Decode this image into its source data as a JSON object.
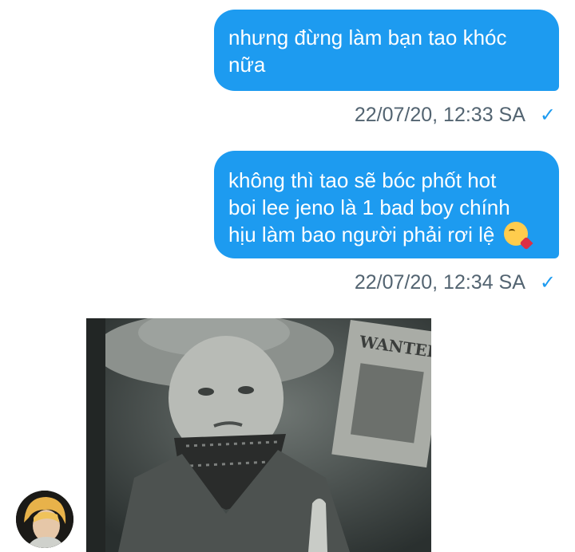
{
  "messages": [
    {
      "lines": [
        "nhưng đừng làm bạn tao khóc",
        "nữa"
      ],
      "timestamp": "22/07/20, 12:33 SA",
      "status_icon": "check-icon"
    },
    {
      "lines": [
        "không thì tao sẽ bóc phốt hot",
        "boi lee jeno là 1 bad boy chính",
        "hịu làm bao người phải rơi lệ"
      ],
      "emoji": "face-blowing-kiss-emoji",
      "timestamp": "22/07/20, 12:34 SA",
      "status_icon": "check-icon"
    }
  ],
  "check_glyph": "✓",
  "photo": {
    "wanted_text": "WANTED"
  },
  "colors": {
    "bubble": "#1d9bf0",
    "timestamp": "#536471",
    "check": "#1d9bf0"
  }
}
